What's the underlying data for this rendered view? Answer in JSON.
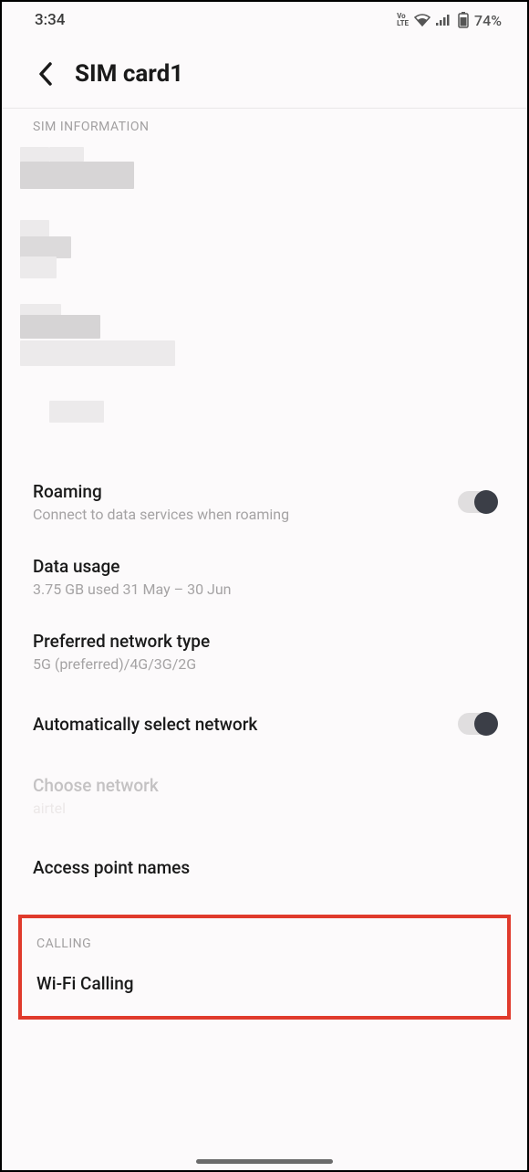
{
  "statusbar": {
    "time": "3:34",
    "volte": "VoLTE",
    "battery": "74%"
  },
  "header": {
    "title": "SIM card1"
  },
  "sections": {
    "sim_info": "SIM INFORMATION",
    "calling": "CALLING"
  },
  "settings": {
    "roaming": {
      "title": "Roaming",
      "sub": "Connect to data services when roaming"
    },
    "data_usage": {
      "title": "Data usage",
      "sub": "3.75 GB used 31 May – 30 Jun"
    },
    "preferred_network": {
      "title": "Preferred network type",
      "sub": "5G (preferred)/4G/3G/2G"
    },
    "auto_select": {
      "title": "Automatically select network"
    },
    "choose_network": {
      "title": "Choose network",
      "sub": "airtel"
    },
    "apn": {
      "title": "Access point names"
    },
    "wifi_calling": {
      "title": "Wi-Fi Calling"
    }
  }
}
